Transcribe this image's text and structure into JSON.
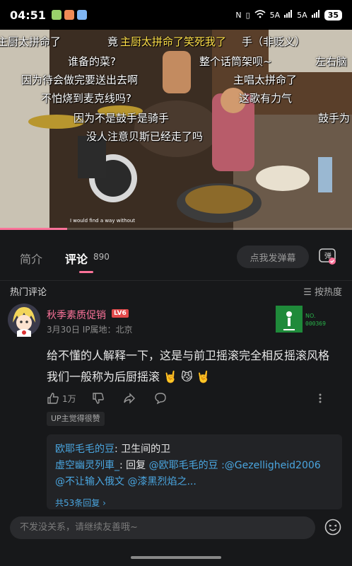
{
  "status_bar": {
    "time": "04:51",
    "signal_1": "5A",
    "signal_2": "5A",
    "battery": "35"
  },
  "video": {
    "subtitle": "I would find a way without",
    "progress": 0.19,
    "danmaku": [
      "主厨太拼命了",
      "竟",
      "主厨太拼命了笑死我了",
      "手（非贬义）",
      "谁备的菜?",
      "整个话筒架呗~",
      "左右脑",
      "因为待会做完要送出去啊",
      "主唱太拼命了",
      "不怕烧到麦克线吗?",
      "这歌有力气",
      "因为不是鼓手是骑手",
      "鼓手为",
      "没人注意贝斯已经走了吗"
    ]
  },
  "tabs": {
    "intro_label": "简介",
    "comments_label": "评论",
    "comments_count": "890",
    "danmaku_placeholder": "点我发弹幕",
    "danmaku_toggle_label": "弹"
  },
  "hot": {
    "title": "热门评论",
    "sort_label": "☰ 按热度"
  },
  "comment": {
    "username": "秋季素质促销",
    "level": "LV6",
    "date": "3月30日",
    "ip_label": "IP属地：北京",
    "deco_no_label": "NO.",
    "deco_no": "000369",
    "body": "给不懂的人解释一下，这是与前卫摇滚完全相反摇滚风格 我们一般称为后厨摇滚 🤘 😼 🤘",
    "like_count": "1万",
    "up_tag": "UP主觉得很赞"
  },
  "replies": {
    "reply1_name": "欧耶毛毛的豆",
    "reply1_text": ": 卫生间的卫",
    "reply2_name": "虚空幽灵列車_",
    "reply2_text": ": 回复 ",
    "reply2_mention": "@欧耶毛毛的豆",
    "reply2_tail": " :@Gezelligheid2006 @不让输入俄文 @漆黑烈焰之...",
    "more": "共53条回复 ›"
  },
  "bottom": {
    "placeholder": "不发没关系，请继续友善哦~"
  },
  "colors": {
    "accent": "#fb7299",
    "link": "#4aa6e0",
    "background": "#17181a",
    "danmaku_yellow": "#ffe04a"
  }
}
